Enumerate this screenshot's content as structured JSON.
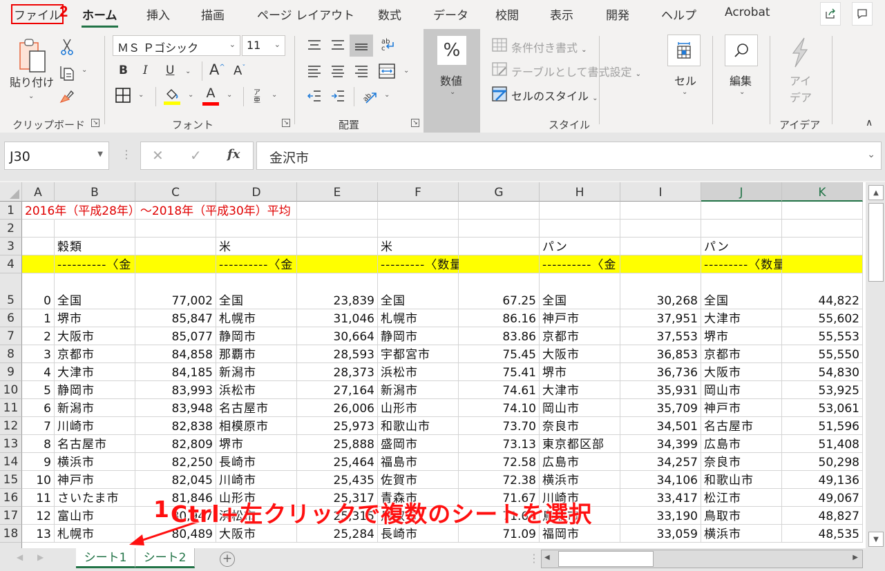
{
  "ribbon_tabs": [
    {
      "label": "ファイル",
      "active": false
    },
    {
      "label": "ホーム",
      "active": true
    },
    {
      "label": "挿入",
      "active": false
    },
    {
      "label": "描画",
      "active": false
    },
    {
      "label": "ページ レイアウト",
      "active": false
    },
    {
      "label": "数式",
      "active": false
    },
    {
      "label": "データ",
      "active": false
    },
    {
      "label": "校閲",
      "active": false
    },
    {
      "label": "表示",
      "active": false
    },
    {
      "label": "開発",
      "active": false
    },
    {
      "label": "ヘルプ",
      "active": false
    },
    {
      "label": "Acrobat",
      "active": false
    }
  ],
  "annotations": {
    "step2": "2",
    "step1": "1",
    "instruction": "Ctrl+左クリックで複数のシートを選択",
    "color": "#ff1010"
  },
  "ribbon": {
    "clipboard": {
      "paste_label": "貼り付け",
      "group_label": "クリップボード"
    },
    "font": {
      "font_name": "ＭＳ Ｐゴシック",
      "font_size": "11",
      "bold": "B",
      "italic": "I",
      "underline": "U",
      "grow": "A",
      "shrink": "A",
      "font_color_letter": "A",
      "phonetic_top": "ア",
      "phonetic_bottom": "亜",
      "group_label": "フォント",
      "fill_color": "#ffff00",
      "font_color": "#ff0000"
    },
    "alignment": {
      "group_label": "配置"
    },
    "number": {
      "icon": "%",
      "label": "数値"
    },
    "styles": {
      "conditional": "条件付き書式",
      "as_table": "テーブルとして書式設定",
      "cell_styles": "セルのスタイル",
      "group_label": "スタイル"
    },
    "cells": {
      "label": "セル"
    },
    "editing": {
      "label": "編集"
    },
    "ideas": {
      "label_line1": "アイ",
      "label_line2": "デア",
      "group_label": "アイデア"
    }
  },
  "formula_bar": {
    "name_box": "J30",
    "cancel": "✕",
    "enter": "✓",
    "fx": "fx",
    "content": "金沢市"
  },
  "columns": [
    "A",
    "B",
    "C",
    "D",
    "E",
    "F",
    "G",
    "H",
    "I",
    "J",
    "K"
  ],
  "selected_columns": [
    "J",
    "K"
  ],
  "rows": [
    {
      "num": "1",
      "cells": {
        "A": "2016年（平成28年）～2018年（平成30年）平均"
      }
    },
    {
      "num": "2",
      "cells": {}
    },
    {
      "num": "3",
      "cells": {
        "B": "穀類",
        "D": "米",
        "F": "米",
        "H": "パン",
        "J": "パン"
      }
    },
    {
      "num": "4",
      "cells": {
        "B": "----------〈金　額〉-",
        "D": "----------〈金　額〉-",
        "F": "---------〈数量:kg〉-",
        "H": "----------〈金　額〉-",
        "J": "---------〈数量:　g〉-"
      }
    },
    {
      "num": "5",
      "cells": {
        "A": "0",
        "B": "全国",
        "C": "77,002",
        "D": "全国",
        "E": "23,839",
        "F": "全国",
        "G": "67.25",
        "H": "全国",
        "I": "30,268",
        "J": "全国",
        "K": "44,822"
      }
    },
    {
      "num": "6",
      "cells": {
        "A": "1",
        "B": "堺市",
        "C": "85,847",
        "D": "札幌市",
        "E": "31,046",
        "F": "札幌市",
        "G": "86.16",
        "H": "神戸市",
        "I": "37,951",
        "J": "大津市",
        "K": "55,602"
      }
    },
    {
      "num": "7",
      "cells": {
        "A": "2",
        "B": "大阪市",
        "C": "85,077",
        "D": "静岡市",
        "E": "30,664",
        "F": "静岡市",
        "G": "83.86",
        "H": "京都市",
        "I": "37,553",
        "J": "堺市",
        "K": "55,553"
      }
    },
    {
      "num": "8",
      "cells": {
        "A": "3",
        "B": "京都市",
        "C": "84,858",
        "D": "那覇市",
        "E": "28,593",
        "F": "宇都宮市",
        "G": "75.45",
        "H": "大阪市",
        "I": "36,853",
        "J": "京都市",
        "K": "55,550"
      }
    },
    {
      "num": "9",
      "cells": {
        "A": "4",
        "B": "大津市",
        "C": "84,185",
        "D": "新潟市",
        "E": "28,373",
        "F": "浜松市",
        "G": "75.41",
        "H": "堺市",
        "I": "36,736",
        "J": "大阪市",
        "K": "54,830"
      }
    },
    {
      "num": "10",
      "cells": {
        "A": "5",
        "B": "静岡市",
        "C": "83,993",
        "D": "浜松市",
        "E": "27,164",
        "F": "新潟市",
        "G": "74.61",
        "H": "大津市",
        "I": "35,931",
        "J": "岡山市",
        "K": "53,925"
      }
    },
    {
      "num": "11",
      "cells": {
        "A": "6",
        "B": "新潟市",
        "C": "83,948",
        "D": "名古屋市",
        "E": "26,006",
        "F": "山形市",
        "G": "74.10",
        "H": "岡山市",
        "I": "35,709",
        "J": "神戸市",
        "K": "53,061"
      }
    },
    {
      "num": "12",
      "cells": {
        "A": "7",
        "B": "川崎市",
        "C": "82,838",
        "D": "相模原市",
        "E": "25,973",
        "F": "和歌山市",
        "G": "73.70",
        "H": "奈良市",
        "I": "34,501",
        "J": "名古屋市",
        "K": "51,596"
      }
    },
    {
      "num": "13",
      "cells": {
        "A": "8",
        "B": "名古屋市",
        "C": "82,809",
        "D": "堺市",
        "E": "25,888",
        "F": "盛岡市",
        "G": "73.13",
        "H": "東京都区部",
        "I": "34,399",
        "J": "広島市",
        "K": "51,408"
      }
    },
    {
      "num": "14",
      "cells": {
        "A": "9",
        "B": "横浜市",
        "C": "82,250",
        "D": "長崎市",
        "E": "25,464",
        "F": "福島市",
        "G": "72.58",
        "H": "広島市",
        "I": "34,257",
        "J": "奈良市",
        "K": "50,298"
      }
    },
    {
      "num": "15",
      "cells": {
        "A": "10",
        "B": "神戸市",
        "C": "82,045",
        "D": "川崎市",
        "E": "25,435",
        "F": "佐賀市",
        "G": "72.38",
        "H": "横浜市",
        "I": "34,106",
        "J": "和歌山市",
        "K": "49,136"
      }
    },
    {
      "num": "16",
      "cells": {
        "A": "11",
        "B": "さいたま市",
        "C": "81,846",
        "D": "山形市",
        "E": "25,317",
        "F": "青森市",
        "G": "71.67",
        "H": "川崎市",
        "I": "33,417",
        "J": "松江市",
        "K": "49,067"
      }
    },
    {
      "num": "17",
      "cells": {
        "A": "12",
        "B": "富山市",
        "C": "80,947",
        "D": "浜松市",
        "E": "25,315",
        "F": "鳥取市",
        "G": "71.64",
        "H": "鳥取市",
        "I": "33,190",
        "J": "鳥取市",
        "K": "48,827"
      }
    },
    {
      "num": "18",
      "cells": {
        "A": "13",
        "B": "札幌市",
        "C": "80,489",
        "D": "大阪市",
        "E": "25,284",
        "F": "長崎市",
        "G": "71.09",
        "H": "福岡市",
        "I": "33,059",
        "J": "横浜市",
        "K": "48,535"
      }
    }
  ],
  "sheet_tabs": [
    {
      "label": "シート1",
      "active": true
    },
    {
      "label": "シート2",
      "active": true
    }
  ],
  "add_sheet": "+",
  "colors": {
    "accent": "#217346",
    "highlight_row": "#ffff00",
    "title_text": "#e00000"
  }
}
